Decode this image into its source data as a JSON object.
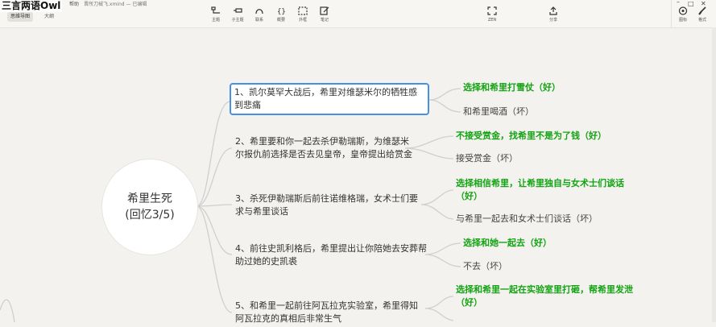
{
  "watermark": "三言两语Owl",
  "menu": [
    "帮助",
    "晋所刀械飞.xmind — 已编辑"
  ],
  "view_tabs": [
    "思维导图",
    "大纲"
  ],
  "toolbar": [
    "主题",
    "子主题",
    "联系",
    "概要",
    "外框",
    "笔记"
  ],
  "zen_label": "ZEN",
  "share_label": "分享",
  "right_tools": [
    "图标",
    "格式"
  ],
  "central": {
    "line1": "希里生死",
    "line2": "(回忆3/5)"
  },
  "topics": [
    "1、凯尔莫罕大战后，希里对维瑟米尔的牺牲感到悲痛",
    "2、希里要和你一起去杀伊勒瑞斯，为维瑟米尔报仇前选择是否去见皇帝，皇帝提出给赏金",
    "3、杀死伊勒瑞斯后前往诺维格瑞，女术士们要求与希里谈话",
    "4、前往史凯利格后，希里提出让你陪她去安葬帮助过她的史凯裘",
    "5、和希里一起前往阿瓦拉克实验室，希里得知阿瓦拉克的真相后非常生气"
  ],
  "options": [
    [
      "选择和希里打雪仗（好）",
      "和希里喝酒（坏）"
    ],
    [
      "不接受赏金，找希里不是为了钱（好）",
      "接受赏金（坏）"
    ],
    [
      "选择相信希里，让希里独自与女术士们谈话（好）",
      "与希里一起去和女术士们谈话（坏）"
    ],
    [
      "选择和她一起去（好）",
      "不去（坏）"
    ],
    [
      "选择和希里一起在实验室里打砸，帮希里发泄（好）"
    ]
  ],
  "colors": {
    "good": "#12a312",
    "selection": "#4a90e2",
    "branch": "#cfcfcf"
  }
}
